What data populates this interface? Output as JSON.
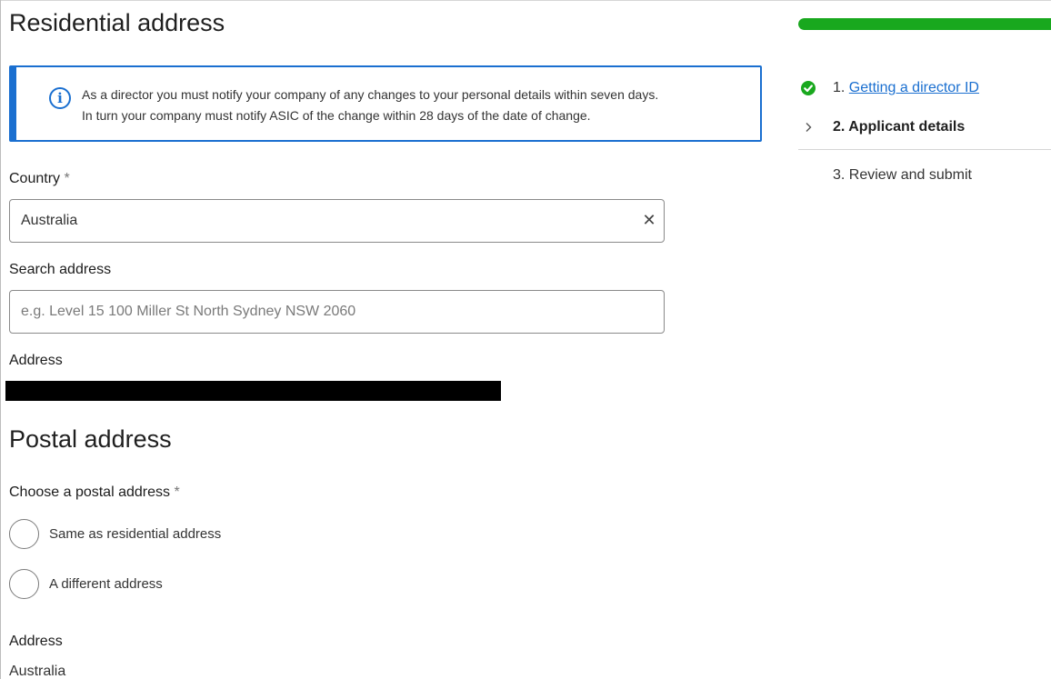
{
  "residential": {
    "title": "Residential address",
    "info_line1": "As a director you must notify your company of any changes to your personal details within seven days.",
    "info_line2": "In turn your company must notify ASIC of the change within 28 days of the date of change.",
    "country_label": "Country",
    "required_mark": "*",
    "country_value": "Australia",
    "search_label": "Search address",
    "search_placeholder": "e.g. Level 15 100 Miller St North Sydney NSW 2060",
    "address_label": "Address"
  },
  "postal": {
    "title": "Postal address",
    "choose_label": "Choose a postal address",
    "required_mark": "*",
    "options": [
      "Same as residential address",
      "A different address"
    ],
    "address_label": "Address",
    "address_value": "Australia"
  },
  "progress": {
    "fraction": 1.0,
    "color": "#19a81e"
  },
  "steps": [
    {
      "number": "1.",
      "label": "Getting a director ID",
      "status": "complete",
      "icon": "check-circle-icon"
    },
    {
      "number": "2.",
      "label": "Applicant details",
      "status": "current",
      "icon": "chevron-right-icon"
    },
    {
      "number": "3.",
      "label": "Review and submit",
      "status": "upcoming",
      "icon": ""
    }
  ],
  "colors": {
    "accent": "#1a6fd0",
    "success": "#19a81e"
  }
}
